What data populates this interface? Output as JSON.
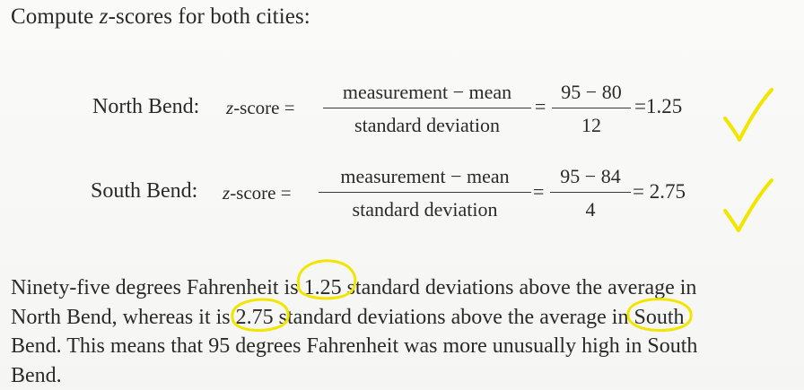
{
  "intro": {
    "prefix": "Compute ",
    "z": "z",
    "suffix": "-scores for both cities:"
  },
  "formula": {
    "zscore_prefix": "z",
    "zscore_suffix": "-score =",
    "numerator": "measurement − mean",
    "denominator": "standard deviation",
    "equals": "="
  },
  "north": {
    "city": "North Bend:",
    "val_num": "95 − 80",
    "val_den": "12",
    "result": "=1.25"
  },
  "south": {
    "city": "South Bend:",
    "val_num": "95 − 84",
    "val_den": "4",
    "result": "= 2.75"
  },
  "paragraph": {
    "l1_a": "Ninety-five degrees Fahrenheit is ",
    "l1_circled": "1.25",
    "l1_b": " standard deviations above the average in",
    "l2_a": "North Bend, whereas it is ",
    "l2_circled": "2.75",
    "l2_b": " standard deviations above the average in ",
    "l2_circled2": "South",
    "l3": "Bend. This means that 95 degrees Fahrenheit was more unusually high in South",
    "l4": "Bend."
  },
  "annotation_color": "#f2e600"
}
